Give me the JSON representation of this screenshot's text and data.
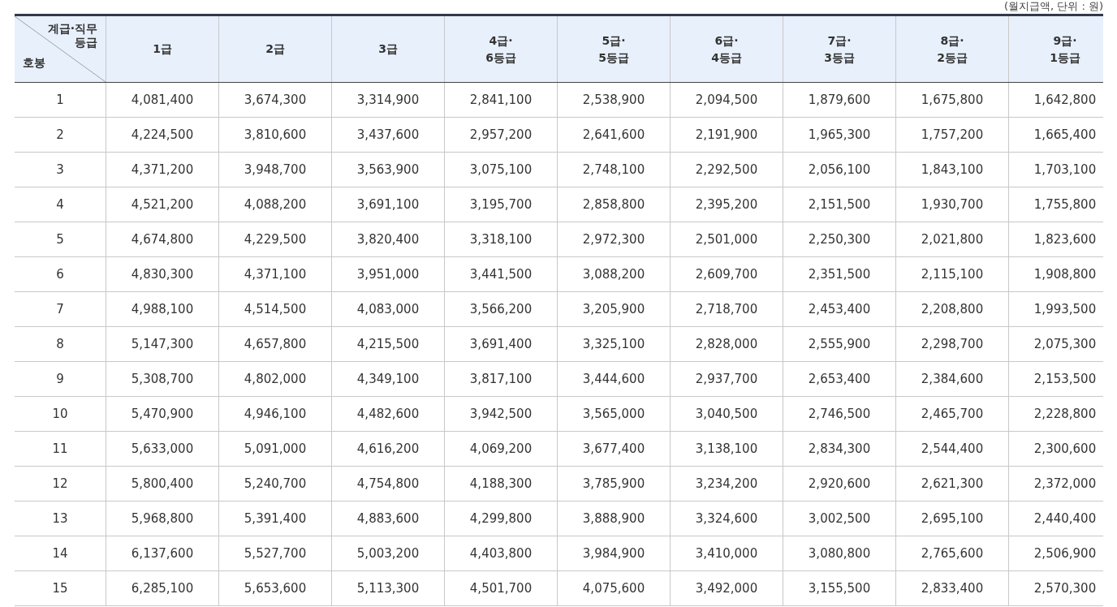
{
  "caption": "(월지급액, 단위 : 원)",
  "corner": {
    "top_lines": [
      "계급·직무",
      "등급"
    ],
    "bottom": "호봉"
  },
  "columns": [
    {
      "lines": [
        "1급"
      ]
    },
    {
      "lines": [
        "2급"
      ]
    },
    {
      "lines": [
        "3급"
      ]
    },
    {
      "lines": [
        "4급·",
        "6등급"
      ]
    },
    {
      "lines": [
        "5급·",
        "5등급"
      ]
    },
    {
      "lines": [
        "6급·",
        "4등급"
      ]
    },
    {
      "lines": [
        "7급·",
        "3등급"
      ]
    },
    {
      "lines": [
        "8급·",
        "2등급"
      ]
    },
    {
      "lines": [
        "9급·",
        "1등급"
      ]
    }
  ],
  "rows": [
    [
      "1",
      "4,081,400",
      "3,674,300",
      "3,314,900",
      "2,841,100",
      "2,538,900",
      "2,094,500",
      "1,879,600",
      "1,675,800",
      "1,642,800"
    ],
    [
      "2",
      "4,224,500",
      "3,810,600",
      "3,437,600",
      "2,957,200",
      "2,641,600",
      "2,191,900",
      "1,965,300",
      "1,757,200",
      "1,665,400"
    ],
    [
      "3",
      "4,371,200",
      "3,948,700",
      "3,563,900",
      "3,075,100",
      "2,748,100",
      "2,292,500",
      "2,056,100",
      "1,843,100",
      "1,703,100"
    ],
    [
      "4",
      "4,521,200",
      "4,088,200",
      "3,691,100",
      "3,195,700",
      "2,858,800",
      "2,395,200",
      "2,151,500",
      "1,930,700",
      "1,755,800"
    ],
    [
      "5",
      "4,674,800",
      "4,229,500",
      "3,820,400",
      "3,318,100",
      "2,972,300",
      "2,501,000",
      "2,250,300",
      "2,021,800",
      "1,823,600"
    ],
    [
      "6",
      "4,830,300",
      "4,371,100",
      "3,951,000",
      "3,441,500",
      "3,088,200",
      "2,609,700",
      "2,351,500",
      "2,115,100",
      "1,908,800"
    ],
    [
      "7",
      "4,988,100",
      "4,514,500",
      "4,083,000",
      "3,566,200",
      "3,205,900",
      "2,718,700",
      "2,453,400",
      "2,208,800",
      "1,993,500"
    ],
    [
      "8",
      "5,147,300",
      "4,657,800",
      "4,215,500",
      "3,691,400",
      "3,325,100",
      "2,828,000",
      "2,555,900",
      "2,298,700",
      "2,075,300"
    ],
    [
      "9",
      "5,308,700",
      "4,802,000",
      "4,349,100",
      "3,817,100",
      "3,444,600",
      "2,937,700",
      "2,653,400",
      "2,384,600",
      "2,153,500"
    ],
    [
      "10",
      "5,470,900",
      "4,946,100",
      "4,482,600",
      "3,942,500",
      "3,565,000",
      "3,040,500",
      "2,746,500",
      "2,465,700",
      "2,228,800"
    ],
    [
      "11",
      "5,633,000",
      "5,091,000",
      "4,616,200",
      "4,069,200",
      "3,677,400",
      "3,138,100",
      "2,834,300",
      "2,544,400",
      "2,300,600"
    ],
    [
      "12",
      "5,800,400",
      "5,240,700",
      "4,754,800",
      "4,188,300",
      "3,785,900",
      "3,234,200",
      "2,920,600",
      "2,621,300",
      "2,372,000"
    ],
    [
      "13",
      "5,968,800",
      "5,391,400",
      "4,883,600",
      "4,299,800",
      "3,888,900",
      "3,324,600",
      "3,002,500",
      "2,695,100",
      "2,440,400"
    ],
    [
      "14",
      "6,137,600",
      "5,527,700",
      "5,003,200",
      "4,403,800",
      "3,984,900",
      "3,410,000",
      "3,080,800",
      "2,765,600",
      "2,506,900"
    ],
    [
      "15",
      "6,285,100",
      "5,653,600",
      "5,113,300",
      "4,501,700",
      "4,075,600",
      "3,492,000",
      "3,155,500",
      "2,833,400",
      "2,570,300"
    ]
  ]
}
